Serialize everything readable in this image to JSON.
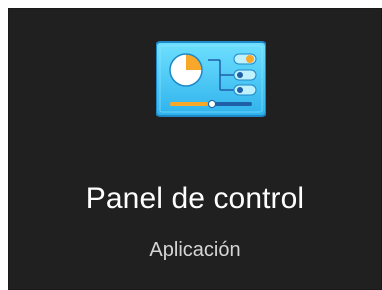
{
  "app": {
    "title": "Panel de control",
    "type_label": "Aplicación",
    "icon": "control-panel-icon"
  },
  "colors": {
    "tile_background": "#202020",
    "title_text": "#ffffff",
    "subtitle_text": "#d6d6d6",
    "icon_primary": "#47c8f5",
    "icon_accent": "#f7a828"
  }
}
